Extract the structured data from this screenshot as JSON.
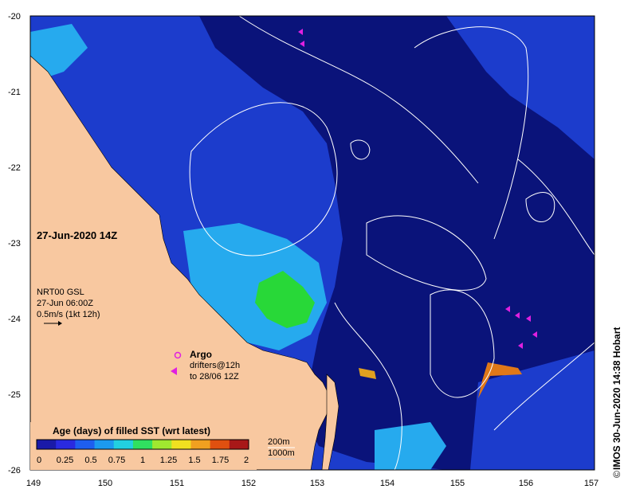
{
  "map": {
    "lat_ticks": [
      "-20",
      "-21",
      "-22",
      "-23",
      "-24",
      "-25",
      "-26"
    ],
    "lon_ticks": [
      "149",
      "150",
      "151",
      "152",
      "153",
      "154",
      "155",
      "156",
      "157"
    ],
    "date_label": "27-Jun-2020 14Z",
    "nrt": {
      "line1": "NRT00 GSL",
      "line2": "27-Jun 06:00Z",
      "line3": "0.5m/s (1kt 12h)"
    },
    "argo_label": "Argo",
    "drifters_line1": "drifters@12h",
    "drifters_line2": "to 28/06 12Z",
    "colorbar": {
      "title": "Age (days) of filled SST (wrt latest)",
      "ticks": [
        "0",
        "0.25",
        "0.5",
        "0.75",
        "1",
        "1.25",
        "1.5",
        "1.75",
        "2"
      ],
      "colors": [
        "#1a1aa8",
        "#2a2ae0",
        "#1e5ef0",
        "#1c9af0",
        "#22d0e0",
        "#30e060",
        "#a0e830",
        "#f0e020",
        "#f0a020",
        "#e05010",
        "#a81818"
      ]
    },
    "isobaths": {
      "line1": "200m",
      "line2": "1000m"
    },
    "credit": "IMOS 30-Jun-2020 14:38 Hobart",
    "colors": {
      "ocean_deep": "#0a137a",
      "ocean_mid": "#1c3ccc",
      "ocean_light": "#26aaee",
      "land": "#f8c8a0",
      "filled_green": "#28d838",
      "drifter": "#e020e0"
    }
  }
}
